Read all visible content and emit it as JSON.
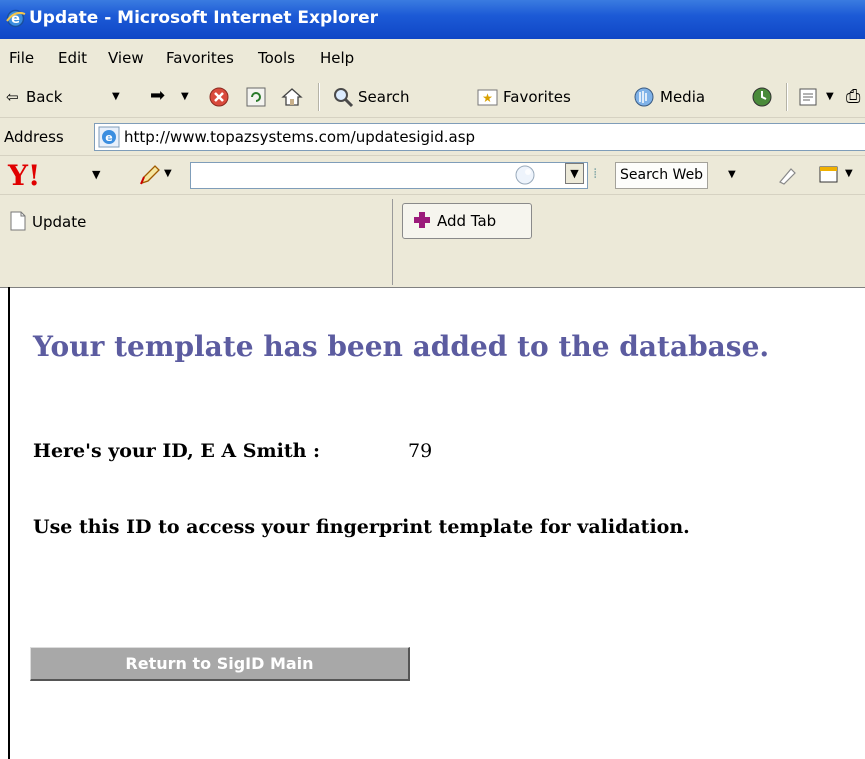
{
  "window": {
    "title": "Update - Microsoft Internet Explorer"
  },
  "menu": [
    "File",
    "Edit",
    "View",
    "Favorites",
    "Tools",
    "Help"
  ],
  "toolbar": {
    "back": "Back",
    "search": "Search",
    "favorites": "Favorites",
    "media": "Media"
  },
  "address": {
    "label": "Address",
    "url": "http://www.topazsystems.com/updatesigid.asp"
  },
  "yahoo": {
    "logo": "Y!",
    "search_button": "Search Web",
    "search_value": ""
  },
  "tabs": {
    "current": "Update",
    "add": "Add Tab"
  },
  "content": {
    "heading": "Your template has been added to the database.",
    "id_label": "Here's your ID, E A Smith :",
    "id_value": "79",
    "instruction": "Use this ID to access your fingerprint template for validation.",
    "return_button": "Return to SigID Main"
  },
  "colors": {
    "titlebar": "#1c5ad6",
    "heading": "#5c5ca0",
    "button": "#a8a8a8",
    "chrome": "#ece9d8"
  }
}
